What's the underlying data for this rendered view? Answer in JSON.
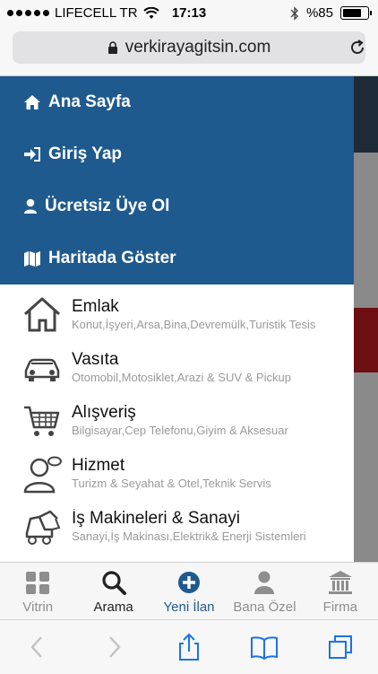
{
  "status_bar": {
    "carrier": "LIFECELL TR",
    "time": "17:13",
    "battery_text": "%85",
    "battery_level": 0.85
  },
  "browser": {
    "url": "verkirayagitsin.com"
  },
  "menu": {
    "primary_items": [
      {
        "label": "Ana Sayfa",
        "icon": "home-icon"
      },
      {
        "label": "Giriş Yap",
        "icon": "sign-in-icon"
      },
      {
        "label": "Ücretsiz Üye Ol",
        "icon": "user-icon"
      },
      {
        "label": "Haritada Göster",
        "icon": "map-icon"
      }
    ],
    "categories": [
      {
        "title": "Emlak",
        "subtitle": "Konut,İşyeri,Arsa,Bina,Devremülk,Turistik Tesis",
        "icon": "house-icon"
      },
      {
        "title": "Vasıta",
        "subtitle": "Otomobil,Motosiklet,Arazi & SUV & Pickup",
        "icon": "car-icon"
      },
      {
        "title": "Alışveriş",
        "subtitle": "Bilgisayar,Cep Telefonu,Giyim & Aksesuar",
        "icon": "cart-icon"
      },
      {
        "title": "Hizmet",
        "subtitle": "Turizm & Seyahat & Otel,Teknik Servis",
        "icon": "person-icon"
      },
      {
        "title": "İş Makineleri & Sanayi",
        "subtitle": "Sanayi,İş Makinası,Elektrik& Enerji Sistemleri",
        "icon": "machine-icon"
      }
    ]
  },
  "tabs": [
    {
      "label": "Vitrin",
      "icon": "grid-icon"
    },
    {
      "label": "Arama",
      "icon": "search-icon"
    },
    {
      "label": "Yeni İlan",
      "icon": "plus-circle-icon"
    },
    {
      "label": "Bana Özel",
      "icon": "user-icon"
    },
    {
      "label": "Firma",
      "icon": "building-icon"
    }
  ],
  "colors": {
    "menu_blue": "#1f5a8e",
    "active_tab": "#1f5a8e"
  }
}
